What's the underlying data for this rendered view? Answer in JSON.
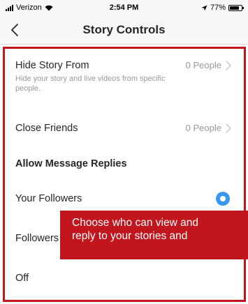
{
  "status_bar": {
    "carrier": "Verizon",
    "time": "2:54 PM",
    "battery": "77%"
  },
  "nav": {
    "title": "Story Controls"
  },
  "hide_story": {
    "label": "Hide Story From",
    "description": "Hide your story and live videos from specific people.",
    "value": "0 People"
  },
  "close_friends": {
    "label": "Close Friends",
    "value": "0 People"
  },
  "message_replies": {
    "title": "Allow Message Replies",
    "options": [
      {
        "label": "Your Followers",
        "selected": true
      },
      {
        "label": "Followers You Follow Back",
        "selected": false
      },
      {
        "label": "Off",
        "selected": false
      }
    ]
  },
  "callout": {
    "text": "Choose who can view and\nreply to your stories and"
  },
  "colors": {
    "accent": "#c1161d",
    "radio_selected": "#3897f0",
    "secondary_text": "#999999"
  }
}
